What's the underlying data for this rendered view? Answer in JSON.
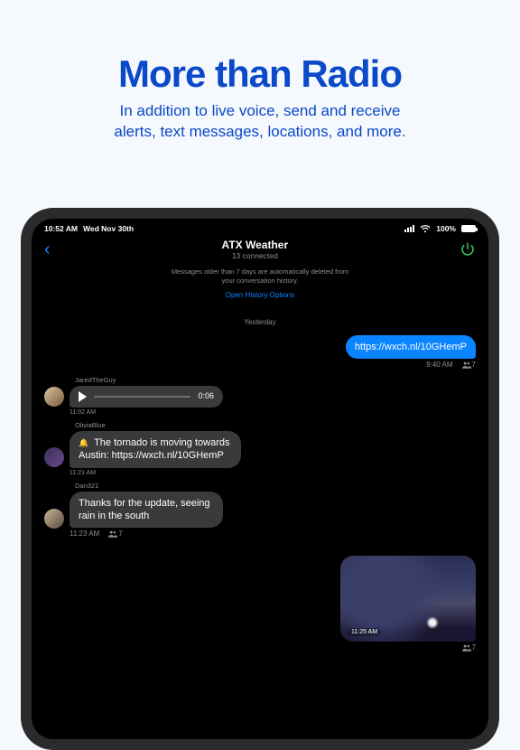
{
  "hero": {
    "title": "More than Radio",
    "subtitle_line1": "In addition to live voice, send and receive",
    "subtitle_line2": "alerts, text messages, locations, and more."
  },
  "statusbar": {
    "time": "10:52 AM",
    "date": "Wed Nov 30th",
    "battery_pct": "100%"
  },
  "header": {
    "title": "ATX Weather",
    "subtitle": "13 connected"
  },
  "notice": {
    "line1": "Messages older than 7 days are automatically deleted from",
    "line2": "your conversation history.",
    "link": "Open History Options"
  },
  "divider": "Yesterday",
  "messages": {
    "m0": {
      "text": "https://wxch.nl/10GHemP",
      "time": "9:40 AM",
      "readers": "7"
    },
    "m1": {
      "sender": "JaredTheGuy",
      "duration": "0:06",
      "time": "11:02 AM"
    },
    "m2": {
      "sender": "OliviaBlue",
      "text": "  The tornado is moving towards Austin: https://wxch.nl/10GHemP",
      "time": "11:21 AM"
    },
    "m3": {
      "sender": "Dan321",
      "text": "Thanks for the update, seeing rain in the south",
      "time": "11:23 AM",
      "readers": "7"
    },
    "m4": {
      "time": "11:25 AM",
      "readers": "7"
    }
  }
}
